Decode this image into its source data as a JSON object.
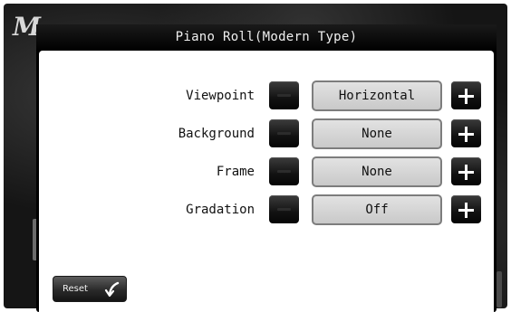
{
  "background": {
    "logo_letter": "M"
  },
  "dialog": {
    "title": "Piano Roll(Modern Type)"
  },
  "settings": [
    {
      "label": "Viewpoint",
      "value": "Horizontal"
    },
    {
      "label": "Background",
      "value": "None"
    },
    {
      "label": "Frame",
      "value": "None"
    },
    {
      "label": "Gradation",
      "value": "Off"
    }
  ],
  "reset": {
    "label": "Reset"
  },
  "icons": {
    "minus": "minus-icon",
    "plus": "plus-icon",
    "reset": "undo-arrow-icon"
  },
  "colors": {
    "title_bar": "#000000",
    "panel": "#ffffff",
    "value_box": "#d4d4d4",
    "button": "#111111"
  }
}
